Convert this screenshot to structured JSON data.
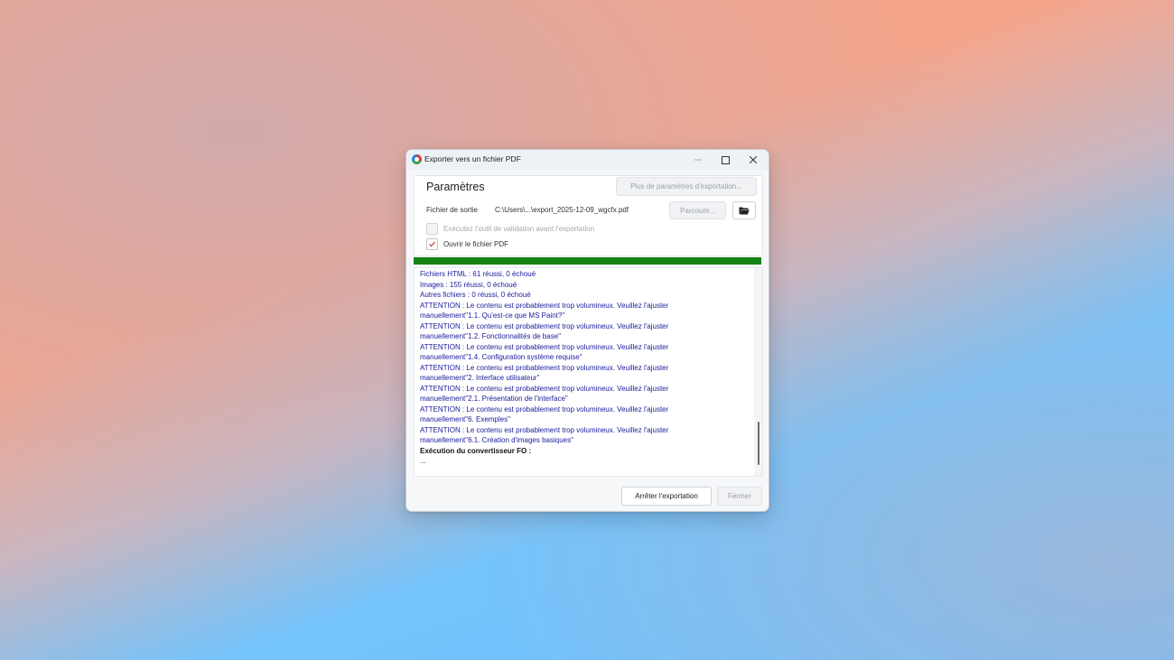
{
  "window": {
    "title": "Exporter vers un fichier PDF",
    "minimize_icon": "minimize-icon",
    "maximize_icon": "maximize-icon",
    "close_symbol": "✕"
  },
  "settings": {
    "title": "Paramètres",
    "more_button": "Plus de paramètres d'exportation...",
    "output_label": "Fichier de sortie",
    "output_path": "C:\\Users\\...\\export_2025-12-09_wgcfx.pdf",
    "browse_button": "Parcourir...",
    "folder_icon": "folder-open-icon",
    "validation_checkbox": {
      "label": "Exécutez l'outil de validation avant l'exportation",
      "checked": false,
      "enabled": false
    },
    "open_pdf_checkbox": {
      "label": "Ouvrir le fichier PDF",
      "checked": true,
      "enabled": true
    }
  },
  "progress": {
    "value": 1.0,
    "color": "#138213"
  },
  "log": {
    "lines": [
      {
        "text": "Fichiers HTML :  61 réussi, 0 échoué",
        "bold": false
      },
      {
        "text": "Images :  155 réussi, 0 échoué",
        "bold": false
      },
      {
        "text": "Autres fichiers :  0 réussi, 0 échoué",
        "bold": false
      },
      {
        "text": "ATTENTION : Le contenu est probablement trop volumineux. Veuillez l'ajuster",
        "bold": false
      },
      {
        "text": "manuellement\"1.1. Qu'est-ce que MS Paint?\"",
        "bold": false
      },
      {
        "text": "ATTENTION : Le contenu est probablement trop volumineux. Veuillez l'ajuster",
        "bold": false
      },
      {
        "text": "manuellement\"1.2. Fonctionnalités de base\"",
        "bold": false
      },
      {
        "text": "ATTENTION : Le contenu est probablement trop volumineux. Veuillez l'ajuster",
        "bold": false
      },
      {
        "text": "manuellement\"1.4. Configuration système requise\"",
        "bold": false
      },
      {
        "text": "ATTENTION : Le contenu est probablement trop volumineux. Veuillez l'ajuster",
        "bold": false
      },
      {
        "text": "manuellement\"2. Interface utilisateur\"",
        "bold": false
      },
      {
        "text": "ATTENTION : Le contenu est probablement trop volumineux. Veuillez l'ajuster",
        "bold": false
      },
      {
        "text": "manuellement\"2.1. Présentation de l'interface\"",
        "bold": false
      },
      {
        "text": "ATTENTION : Le contenu est probablement trop volumineux. Veuillez l'ajuster",
        "bold": false
      },
      {
        "text": "manuellement\"6. Exemples\"",
        "bold": false
      },
      {
        "text": "ATTENTION : Le contenu est probablement trop volumineux. Veuillez l'ajuster",
        "bold": false
      },
      {
        "text": "manuellement\"6.1. Création d'images basiques\"",
        "bold": false
      },
      {
        "text": "Exécution du convertisseur FO :",
        "bold": true
      },
      {
        "text": "...",
        "bold": false
      }
    ]
  },
  "footer": {
    "stop_button": "Arrêter l'exportation",
    "close_button": "Fermer"
  },
  "colors": {
    "log_text": "#1a1a9c",
    "checkmark": "#c0392b"
  }
}
